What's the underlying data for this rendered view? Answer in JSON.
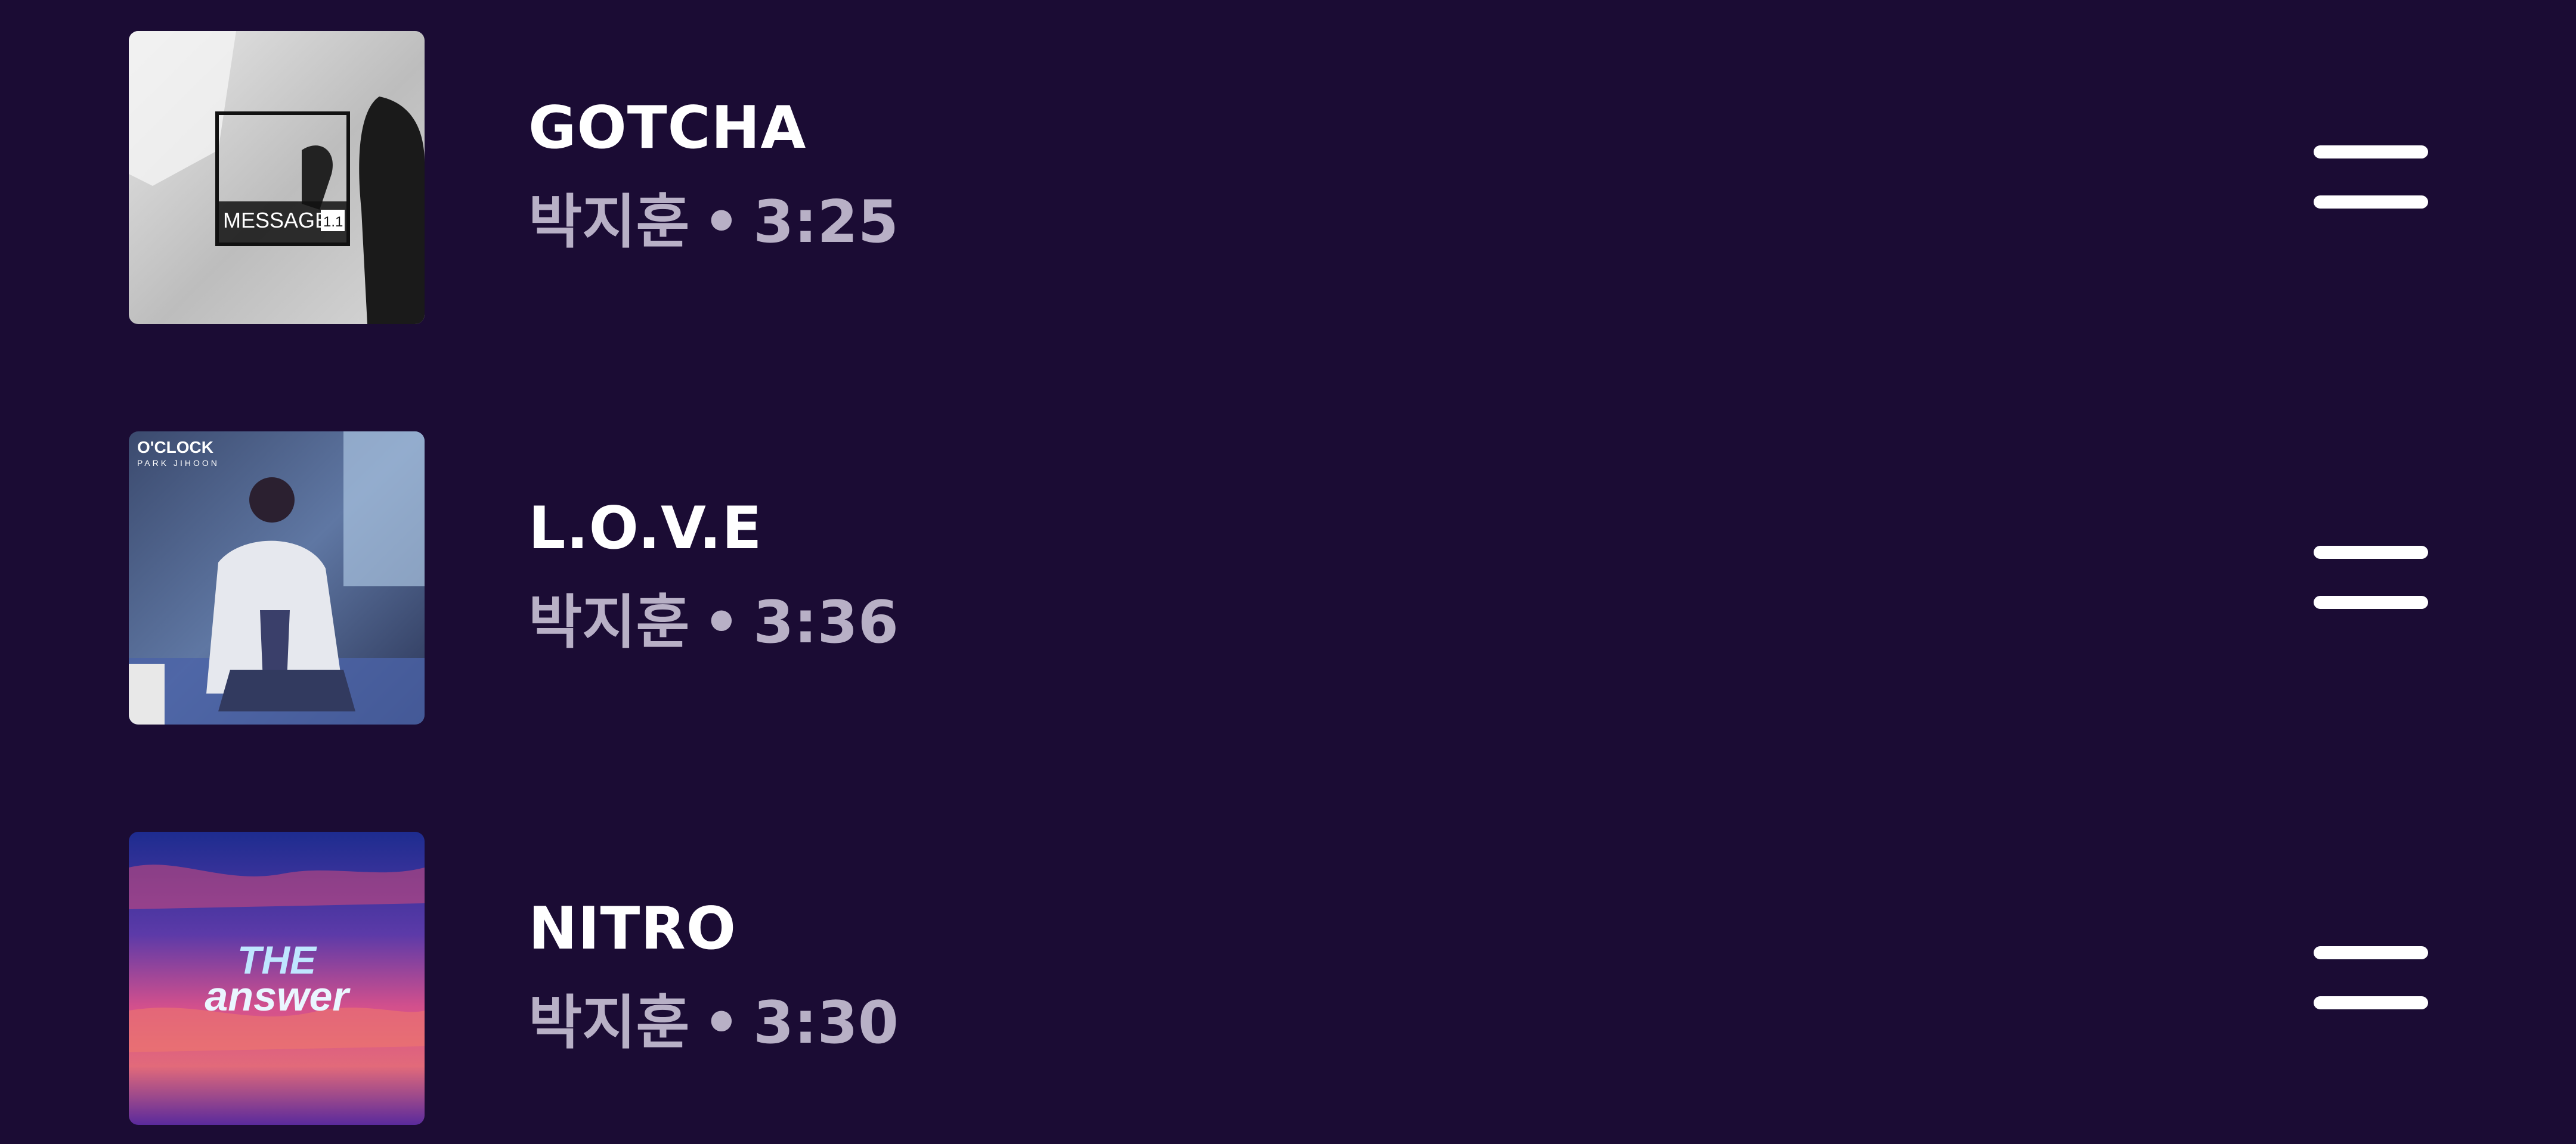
{
  "tracks": [
    {
      "title": "GOTCHA",
      "artist": "박지훈",
      "separator": "•",
      "duration": "3:25",
      "cover": {
        "text": "MESSAGE",
        "badge": "1.1"
      },
      "handle_icon": "drag-handle-icon"
    },
    {
      "title": "L.O.V.E",
      "artist": "박지훈",
      "separator": "•",
      "duration": "3:36",
      "cover": {
        "text": "O'CLOCK",
        "subtext": "PARK JIHOON"
      },
      "handle_icon": "drag-handle-icon"
    },
    {
      "title": "NITRO",
      "artist": "박지훈",
      "separator": "•",
      "duration": "3:30",
      "cover": {
        "text_top": "THE",
        "text_bottom": "answer"
      },
      "handle_icon": "drag-handle-icon"
    }
  ],
  "colors": {
    "background": "#1b0c34",
    "title": "#ffffff",
    "meta": "#b8b0c6",
    "handle": "#ffffff"
  }
}
